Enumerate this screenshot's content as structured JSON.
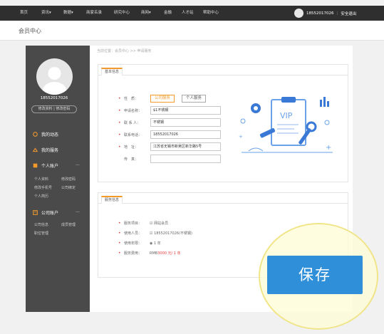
{
  "nav": {
    "items": [
      "首页",
      "资讯",
      "数据",
      "商家名录",
      "研究中心",
      "商网",
      "金融",
      "人才站",
      "帮助中心"
    ],
    "dropdown_marks": [
      "▾",
      "▾",
      "▾"
    ],
    "phone": "18552017026",
    "separator": "|",
    "logout": "安全退出"
  },
  "page": {
    "title": "会员中心"
  },
  "sidebar": {
    "phone": "18552017026",
    "links": "修改资料 | 修改密码",
    "menu": [
      {
        "label": "我的动态",
        "icon": "activity-icon"
      },
      {
        "label": "我的服务",
        "icon": "service-icon"
      },
      {
        "label": "个人账户",
        "icon": "person-account-icon",
        "arrow": "—"
      },
      {
        "label": "公司账户",
        "icon": "company-account-icon",
        "arrow": "—"
      }
    ],
    "personal_sub": [
      "个人资料",
      "修改密码",
      "修改手机号",
      "公司绑定",
      "个人简历"
    ],
    "company_sub": [
      "公司信息",
      "成员管理",
      "职位管理"
    ]
  },
  "content": {
    "breadcrumb": "当前位置：会员中心 >> 申请服务",
    "basic": {
      "tab": "基本信息",
      "type_label": "性　质：",
      "type_options": [
        "公司服务",
        "个人服务"
      ],
      "fields": [
        {
          "label": "申请名称：",
          "value": "$1不锈钢",
          "required": true
        },
        {
          "label": "联 系 人：",
          "value": "不锈钢",
          "required": true
        },
        {
          "label": "联系电话：",
          "value": "18552017026",
          "required": true
        },
        {
          "label": "地　址：",
          "value": "江苏省无锡市新吴区新华路5号",
          "required": true
        },
        {
          "label": "传　真：",
          "value": "",
          "required": false
        }
      ],
      "illustration_text": "VIP"
    },
    "service": {
      "tab": "服务信息",
      "rows": [
        {
          "label": "服务项目：",
          "value": "☑ 网站会员"
        },
        {
          "label": "使用人员：",
          "value": "☑ 18552017026(不锈钢)"
        },
        {
          "label": "使用年限：",
          "value": "◉ 1 年"
        },
        {
          "label": "服务费用：",
          "value_prefix": "RMB ",
          "value_red": "3000 元/ 1 年"
        }
      ]
    },
    "save_label": "保存"
  },
  "colors": {
    "accent": "#f39a2b",
    "save": "#2f8fd8",
    "sidebar": "#4a4a4a",
    "topbar": "#2f2f2f"
  }
}
